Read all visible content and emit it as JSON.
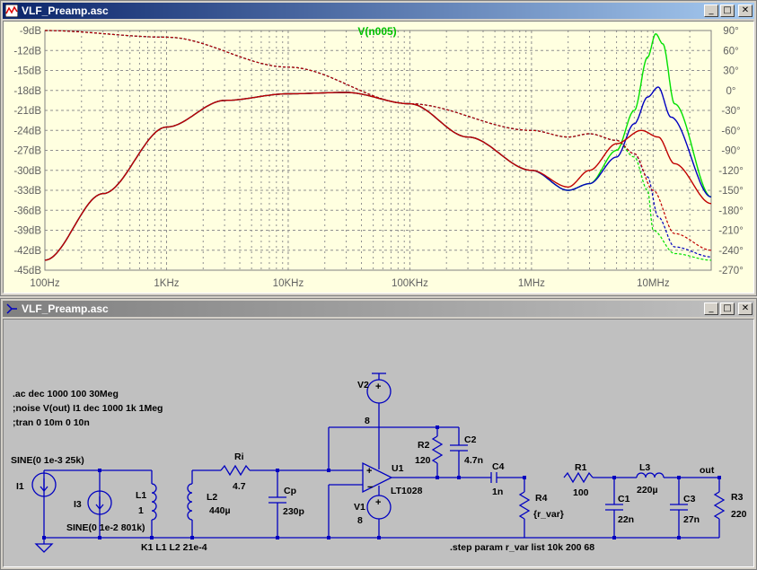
{
  "plot_window": {
    "title": "VLF_Preamp.asc",
    "trace_label": "V(n005)"
  },
  "schematic_window": {
    "title": "VLF_Preamp.asc"
  },
  "chart_data": {
    "type": "line",
    "title": "V(n005)",
    "x_scale": "log",
    "x_range": [
      100,
      30000000
    ],
    "x_ticks": [
      "100Hz",
      "1KHz",
      "10KHz",
      "100KHz",
      "1MHz",
      "10MHz"
    ],
    "y_left_ticks": [
      "-9dB",
      "-12dB",
      "-15dB",
      "-18dB",
      "-21dB",
      "-24dB",
      "-27dB",
      "-30dB",
      "-33dB",
      "-36dB",
      "-39dB",
      "-42dB",
      "-45dB"
    ],
    "y_left_range": [
      -45,
      -9
    ],
    "y_right_ticks": [
      "90°",
      "60°",
      "30°",
      "0°",
      "-30°",
      "-60°",
      "-90°",
      "-120°",
      "-150°",
      "-180°",
      "-210°",
      "-240°",
      "-270°"
    ],
    "y_right_range": [
      -270,
      90
    ],
    "grid": true,
    "series": [
      {
        "color": "#00e000",
        "magnitude": [
          [
            100,
            -43.5
          ],
          [
            300,
            -33.5
          ],
          [
            1000,
            -23.5
          ],
          [
            3000,
            -19.5
          ],
          [
            10000,
            -18.5
          ],
          [
            30000,
            -18.3
          ],
          [
            100000,
            -20
          ],
          [
            300000,
            -25
          ],
          [
            1000000,
            -30
          ],
          [
            2000000,
            -33
          ],
          [
            3000000,
            -32
          ],
          [
            5000000,
            -27
          ],
          [
            7000000,
            -21
          ],
          [
            9000000,
            -13
          ],
          [
            10500000,
            -9.5
          ],
          [
            12000000,
            -11
          ],
          [
            15000000,
            -20
          ],
          [
            30000000,
            -34
          ]
        ],
        "phase": [
          [
            100,
            90
          ],
          [
            1000,
            80
          ],
          [
            10000,
            35
          ],
          [
            100000,
            -20
          ],
          [
            1000000,
            -60
          ],
          [
            2000000,
            -70
          ],
          [
            3000000,
            -65
          ],
          [
            5000000,
            -75
          ],
          [
            7000000,
            -100
          ],
          [
            9000000,
            -150
          ],
          [
            10000000,
            -210
          ],
          [
            15000000,
            -245
          ],
          [
            30000000,
            -255
          ]
        ]
      },
      {
        "color": "#0000c0",
        "magnitude": [
          [
            100,
            -43.5
          ],
          [
            300,
            -33.5
          ],
          [
            1000,
            -23.5
          ],
          [
            3000,
            -19.5
          ],
          [
            10000,
            -18.5
          ],
          [
            30000,
            -18.3
          ],
          [
            100000,
            -20
          ],
          [
            300000,
            -25
          ],
          [
            1000000,
            -30
          ],
          [
            2000000,
            -33
          ],
          [
            3000000,
            -32
          ],
          [
            5000000,
            -28
          ],
          [
            7000000,
            -23
          ],
          [
            9000000,
            -19
          ],
          [
            11000000,
            -17.5
          ],
          [
            14000000,
            -22
          ],
          [
            30000000,
            -34
          ]
        ],
        "phase": [
          [
            100,
            90
          ],
          [
            1000,
            80
          ],
          [
            10000,
            35
          ],
          [
            100000,
            -20
          ],
          [
            1000000,
            -60
          ],
          [
            2000000,
            -70
          ],
          [
            3000000,
            -65
          ],
          [
            5000000,
            -75
          ],
          [
            7000000,
            -95
          ],
          [
            9000000,
            -130
          ],
          [
            11000000,
            -190
          ],
          [
            15000000,
            -235
          ],
          [
            30000000,
            -250
          ]
        ]
      },
      {
        "color": "#c00000",
        "magnitude": [
          [
            100,
            -43.5
          ],
          [
            300,
            -33.5
          ],
          [
            1000,
            -23.5
          ],
          [
            3000,
            -19.5
          ],
          [
            10000,
            -18.5
          ],
          [
            30000,
            -18.3
          ],
          [
            100000,
            -20
          ],
          [
            300000,
            -25
          ],
          [
            1000000,
            -30
          ],
          [
            2000000,
            -32.5
          ],
          [
            3000000,
            -30
          ],
          [
            5000000,
            -26
          ],
          [
            8000000,
            -24
          ],
          [
            11000000,
            -25
          ],
          [
            15000000,
            -29
          ],
          [
            30000000,
            -35
          ]
        ],
        "phase": [
          [
            100,
            90
          ],
          [
            1000,
            80
          ],
          [
            10000,
            35
          ],
          [
            100000,
            -20
          ],
          [
            1000000,
            -60
          ],
          [
            2000000,
            -70
          ],
          [
            3000000,
            -65
          ],
          [
            5000000,
            -75
          ],
          [
            7000000,
            -95
          ],
          [
            10000000,
            -150
          ],
          [
            15000000,
            -215
          ],
          [
            30000000,
            -240
          ]
        ]
      }
    ]
  },
  "schematic": {
    "directives": [
      ".ac dec 1000 100 30Meg",
      ";noise V(out) I1 dec 1000 1k 1Meg",
      ";tran 0 10m 0 10n"
    ],
    "labels": {
      "I1": "I1",
      "I1_value": "SINE(0 1e-3 25k)",
      "I3": "I3",
      "I3_value": "SINE(0 1e-2 801k)",
      "L1": "L1",
      "L1_value": "1",
      "L2": "L2",
      "L2_value": "440µ",
      "coupling": "K1 L1 L2 21e-4",
      "Ri": "Ri",
      "Ri_value": "4.7",
      "Cp": "Cp",
      "Cp_value": "230p",
      "V2": "V2",
      "V2_value": "8",
      "V1": "V1",
      "V1_value": "8",
      "U1": "U1",
      "U1_value": "LT1028",
      "R2": "R2",
      "R2_value": "120",
      "C2": "C2",
      "C2_value": "4.7n",
      "C4": "C4",
      "C4_value": "1n",
      "R4": "R4",
      "R4_value": "{r_var}",
      "R1": "R1",
      "R1_value": "100",
      "L3": "L3",
      "L3_value": "220µ",
      "C1": "C1",
      "C1_value": "22n",
      "C3": "C3",
      "C3_value": "27n",
      "R3": "R3",
      "R3_value": "220",
      "out": "out",
      "step": ".step param r_var list 10k 200 68"
    }
  },
  "colors": {
    "plot_bg": "#ffffe0",
    "schematic_bg": "#c0c0c0",
    "wire": "#0000c0",
    "text": "#000000"
  }
}
